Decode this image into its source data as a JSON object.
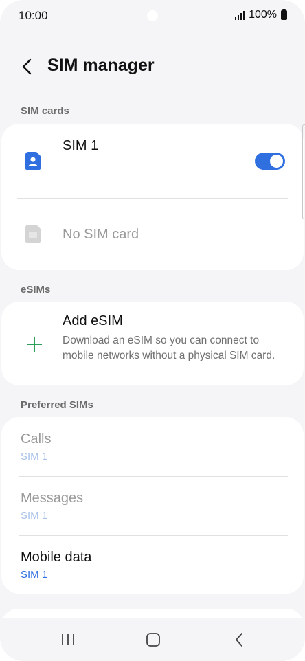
{
  "status_bar": {
    "time": "10:00",
    "battery": "100%"
  },
  "header": {
    "title": "SIM manager"
  },
  "sections": {
    "sim_cards": "SIM cards",
    "esims": "eSIMs",
    "preferred": "Preferred SIMs"
  },
  "sim_cards": [
    {
      "label": "SIM 1",
      "enabled": true
    },
    {
      "label": "No SIM card",
      "enabled": false
    }
  ],
  "esim": {
    "title": "Add eSIM",
    "description": "Download an eSIM so you can connect to mobile networks without a physical SIM card."
  },
  "preferred": [
    {
      "title": "Calls",
      "value": "SIM 1",
      "enabled": false
    },
    {
      "title": "Messages",
      "value": "SIM 1",
      "enabled": false
    },
    {
      "title": "Mobile data",
      "value": "SIM 1",
      "enabled": true
    }
  ],
  "icons": {
    "back": "chevron-left-icon",
    "sim": "sim-card-icon",
    "plus": "plus-icon",
    "recents": "recents-icon",
    "home": "home-icon",
    "nav_back": "back-icon"
  },
  "colors": {
    "accent": "#2f6fe0",
    "plus": "#2e9e5b",
    "background": "#f5f5f7"
  }
}
